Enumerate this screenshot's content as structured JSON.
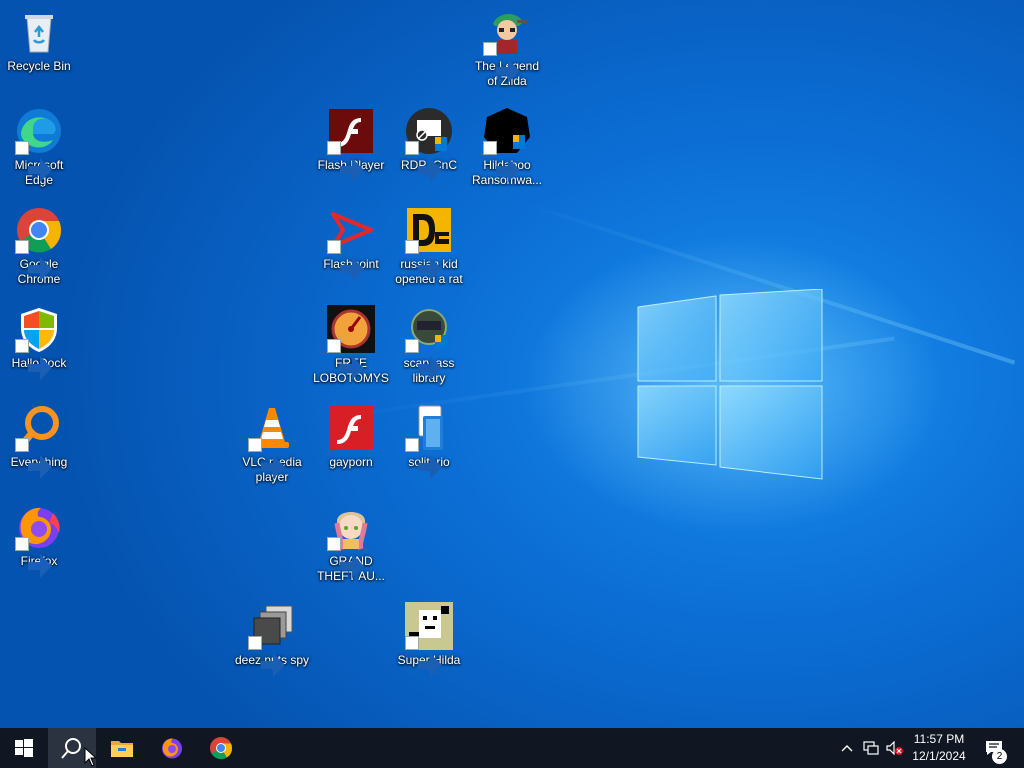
{
  "desktop": {
    "icons": [
      {
        "label": "Recycle Bin",
        "icon": "recycle-bin-icon"
      },
      {
        "label": "Microsoft Edge",
        "icon": "edge-icon"
      },
      {
        "label": "Google Chrome",
        "icon": "chrome-icon"
      },
      {
        "label": "HalloDock",
        "icon": "shield-icon"
      },
      {
        "label": "Everything",
        "icon": "search-magnifier-icon"
      },
      {
        "label": "Firefox",
        "icon": "firefox-icon"
      },
      {
        "label": "VLC media player",
        "icon": "vlc-cone-icon"
      },
      {
        "label": "deez nuts spy",
        "icon": "stacked-windows-icon"
      },
      {
        "label": "Flash Player",
        "icon": "flash-player-icon"
      },
      {
        "label": "Flashpoint",
        "icon": "flashpoint-icon"
      },
      {
        "label": "FREE LOBOTOMYS",
        "icon": "gauge-icon"
      },
      {
        "label": "gayporn",
        "icon": "flash-icon"
      },
      {
        "label": "GRAND THEFT AU...",
        "icon": "anime-character-icon"
      },
      {
        "label": "The Legend of Zilda",
        "icon": "game-character-icon"
      },
      {
        "label": "RDP_CnC",
        "icon": "remote-desktop-icon"
      },
      {
        "label": "russian kid opened a rat",
        "icon": "de-logo-icon"
      },
      {
        "label": "scary ass library",
        "icon": "library-badge-icon"
      },
      {
        "label": "solitario",
        "icon": "solitaire-icon"
      },
      {
        "label": "Super Hilda",
        "icon": "pixel-art-icon"
      },
      {
        "label": "Hildaboo Ransomwa...",
        "icon": "yashma-icon"
      }
    ]
  },
  "taskbar": {
    "start": "windows-start-icon",
    "search": "search-icon",
    "pinned": [
      "file-explorer-icon",
      "firefox-icon",
      "chrome-icon"
    ],
    "tray_icons": [
      "chevron-up-icon",
      "network-icon",
      "volume-muted-icon"
    ],
    "time": "11:57 PM",
    "date": "12/1/2024",
    "notification_count": "2"
  },
  "colors": {
    "desktop_blue": "#0c6fd6",
    "taskbar": "#101722",
    "accent_light": "#8fd8ff"
  }
}
